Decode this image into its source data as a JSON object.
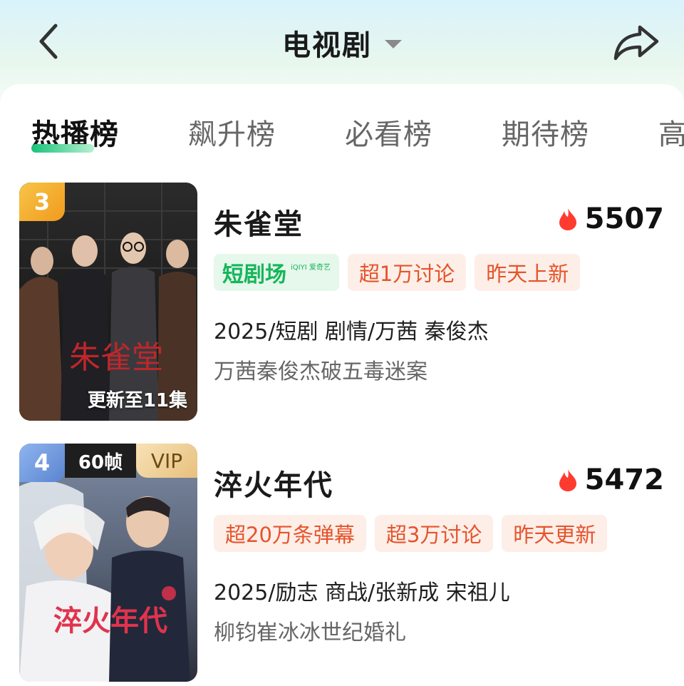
{
  "header": {
    "title": "电视剧",
    "back_icon": "chevron-left-icon",
    "share_icon": "share-arrow-icon",
    "dropdown_icon": "caret-down-icon"
  },
  "tabs": [
    {
      "label": "热播榜",
      "active": true
    },
    {
      "label": "飙升榜",
      "active": false
    },
    {
      "label": "必看榜",
      "active": false
    },
    {
      "label": "期待榜",
      "active": false
    },
    {
      "label": "高",
      "active": false
    }
  ],
  "items": [
    {
      "rank": "3",
      "title": "朱雀堂",
      "heat": "5507",
      "poster_caption": "更新至11集",
      "poster_title": "朱雀堂",
      "brand_tag": {
        "main": "短剧场",
        "small": "iQIYI 爱奇艺"
      },
      "tags": [
        "超1万讨论",
        "昨天上新"
      ],
      "meta": "2025/短剧 剧情/万茜 秦俊杰",
      "desc": "万茜秦俊杰破五毒迷案"
    },
    {
      "rank": "4",
      "title": "淬火年代",
      "heat": "5472",
      "fps_badge": "60帧",
      "vip_badge": "VIP",
      "poster_title": "淬火年代",
      "tags": [
        "超20万条弹幕",
        "超3万讨论",
        "昨天更新"
      ],
      "meta": "2025/励志 商战/张新成 宋祖儿",
      "desc": "柳钧崔冰冰世纪婚礼"
    }
  ],
  "colors": {
    "accent_green": "#18c37a",
    "tag_text": "#e5542b",
    "tag_bg": "#fdeee8",
    "heat_icon": "#ff3b30",
    "rank_gold": "#f19a1d",
    "rank_blue": "#5b84cf"
  }
}
